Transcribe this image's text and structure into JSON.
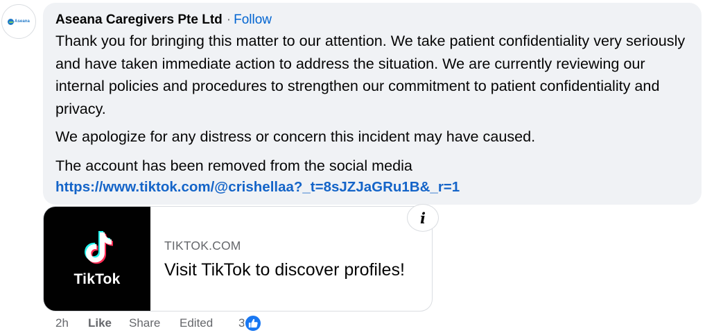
{
  "page": {
    "avatar": {
      "logo_text": "Aseana",
      "icon": "company-logo-icon"
    },
    "comment": {
      "author": "Aseana Caregivers Pte Ltd",
      "separator": "·",
      "follow_label": "Follow",
      "paragraph1": "Thank you for bringing this matter to our attention. We take patient confidentiality very seriously and have taken immediate action to address the situation. We are currently reviewing our internal policies and procedures to strengthen our commitment to patient confidentiality and privacy.",
      "paragraph2": "We apologize for any distress or concern this incident may have caused.",
      "paragraph3": "The account has been removed from the social media",
      "link": "https://www.tiktok.com/@crishellaa?_t=8sJZJaGRu1B&_r=1"
    },
    "preview": {
      "thumb_word": "TikTok",
      "thumb_icon": "tiktok-logo-icon",
      "domain": "TIKTOK.COM",
      "title": "Visit TikTok to discover profiles!",
      "info_glyph": "i",
      "info_icon": "info-icon"
    },
    "actions": {
      "time": "2h",
      "like": "Like",
      "share": "Share",
      "edited": "Edited",
      "reaction_count": "3",
      "reaction_icon": "thumbs-up-icon"
    },
    "colors": {
      "bubble_bg": "#f0f2f5",
      "link": "#1464c8",
      "follow": "#0064d1",
      "like_badge": "#1877f2",
      "muted": "#65676b"
    }
  }
}
